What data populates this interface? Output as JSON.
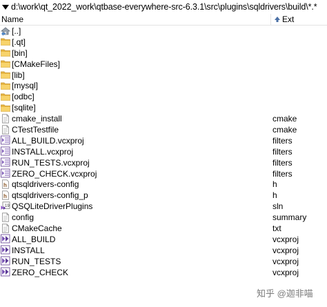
{
  "path_bar": {
    "path": "d:\\work\\qt_2022_work\\qtbase-everywhere-src-6.3.1\\src\\plugins\\sqldrivers\\build\\*.*"
  },
  "header": {
    "name_label": "Name",
    "ext_label": "Ext"
  },
  "files": [
    {
      "name": "[..]",
      "ext": "",
      "icon": "parent-dir-icon"
    },
    {
      "name": "[.qt]",
      "ext": "",
      "icon": "folder-icon"
    },
    {
      "name": "[bin]",
      "ext": "",
      "icon": "folder-icon"
    },
    {
      "name": "[CMakeFiles]",
      "ext": "",
      "icon": "folder-icon"
    },
    {
      "name": "[lib]",
      "ext": "",
      "icon": "folder-icon"
    },
    {
      "name": "[mysql]",
      "ext": "",
      "icon": "folder-icon"
    },
    {
      "name": "[odbc]",
      "ext": "",
      "icon": "folder-icon"
    },
    {
      "name": "[sqlite]",
      "ext": "",
      "icon": "folder-icon"
    },
    {
      "name": "cmake_install",
      "ext": "cmake",
      "icon": "text-file-icon"
    },
    {
      "name": "CTestTestfile",
      "ext": "cmake",
      "icon": "text-file-icon"
    },
    {
      "name": "ALL_BUILD.vcxproj",
      "ext": "filters",
      "icon": "vcxproj-filters-icon"
    },
    {
      "name": "INSTALL.vcxproj",
      "ext": "filters",
      "icon": "vcxproj-filters-icon"
    },
    {
      "name": "RUN_TESTS.vcxproj",
      "ext": "filters",
      "icon": "vcxproj-filters-icon"
    },
    {
      "name": "ZERO_CHECK.vcxproj",
      "ext": "filters",
      "icon": "vcxproj-filters-icon"
    },
    {
      "name": "qtsqldrivers-config",
      "ext": "h",
      "icon": "header-file-icon"
    },
    {
      "name": "qtsqldrivers-config_p",
      "ext": "h",
      "icon": "header-file-icon"
    },
    {
      "name": "QSQLiteDriverPlugins",
      "ext": "sln",
      "icon": "solution-file-icon"
    },
    {
      "name": "config",
      "ext": "summary",
      "icon": "text-file-icon"
    },
    {
      "name": "CMakeCache",
      "ext": "txt",
      "icon": "text-file-icon"
    },
    {
      "name": "ALL_BUILD",
      "ext": "vcxproj",
      "icon": "vcxproj-icon"
    },
    {
      "name": "INSTALL",
      "ext": "vcxproj",
      "icon": "vcxproj-icon"
    },
    {
      "name": "RUN_TESTS",
      "ext": "vcxproj",
      "icon": "vcxproj-icon"
    },
    {
      "name": "ZERO_CHECK",
      "ext": "vcxproj",
      "icon": "vcxproj-icon"
    }
  ],
  "watermark": {
    "text": "知乎 @迦非喵"
  }
}
